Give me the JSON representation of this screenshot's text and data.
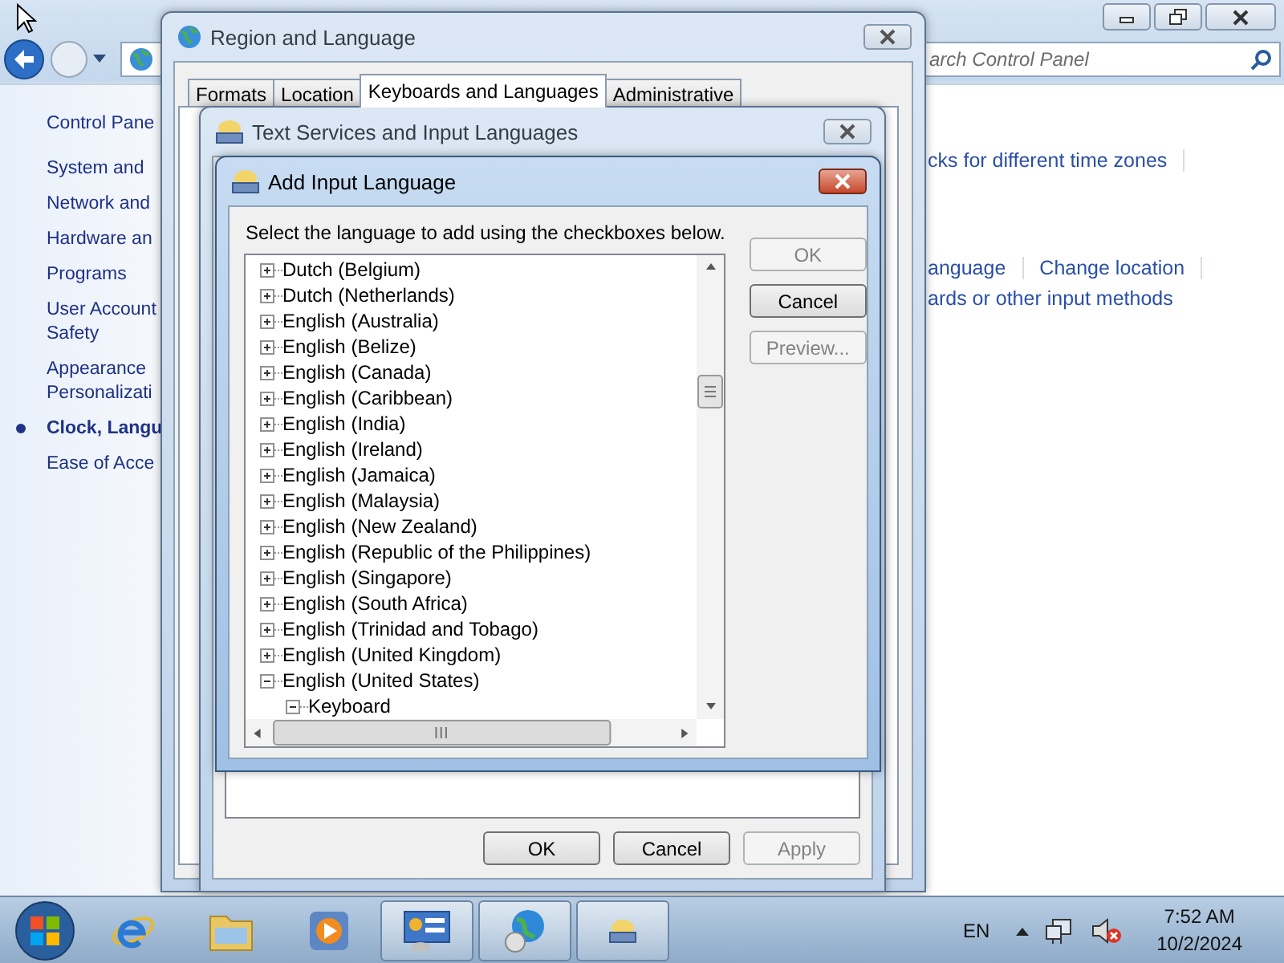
{
  "control_panel": {
    "search": {
      "placeholder": "arch Control Panel"
    },
    "sidebar": {
      "home": "Control Pane",
      "items": [
        {
          "lines": [
            "System and"
          ],
          "selected": false
        },
        {
          "lines": [
            "Network and"
          ],
          "selected": false
        },
        {
          "lines": [
            "Hardware an"
          ],
          "selected": false
        },
        {
          "lines": [
            "Programs"
          ],
          "selected": false
        },
        {
          "lines": [
            "User Account",
            "Safety"
          ],
          "selected": false
        },
        {
          "lines": [
            "Appearance",
            "Personalizati"
          ],
          "selected": false
        },
        {
          "lines": [
            "Clock, Langu"
          ],
          "selected": true
        },
        {
          "lines": [
            "Ease of Acce"
          ],
          "selected": false
        }
      ]
    },
    "link_groups": [
      {
        "rows": [
          {
            "links": [
              "cks for different time zones"
            ],
            "divided": true
          }
        ]
      },
      {
        "rows": [
          {
            "links": [
              "anguage",
              "Change location"
            ],
            "divided": true
          },
          {
            "links": [
              "ards or other input methods"
            ],
            "divided": false
          }
        ]
      }
    ]
  },
  "region_dialog": {
    "title": "Region and Language",
    "tabs": [
      {
        "label": "Formats",
        "selected": false
      },
      {
        "label": "Location",
        "selected": false
      },
      {
        "label": "Keyboards and Languages",
        "selected": true
      },
      {
        "label": "Administrative",
        "selected": false
      }
    ]
  },
  "text_services_dialog": {
    "title": "Text Services and Input Languages",
    "buttons": [
      {
        "label": "OK",
        "disabled": false
      },
      {
        "label": "Cancel",
        "disabled": false
      },
      {
        "label": "Apply",
        "disabled": true
      }
    ]
  },
  "add_input_dialog": {
    "title": "Add Input Language",
    "instruction": "Select the language to add using the checkboxes below.",
    "tree": [
      {
        "label": "Dutch (Belgium)",
        "expanded": false
      },
      {
        "label": "Dutch (Netherlands)",
        "expanded": false
      },
      {
        "label": "English (Australia)",
        "expanded": false
      },
      {
        "label": "English (Belize)",
        "expanded": false
      },
      {
        "label": "English (Canada)",
        "expanded": false
      },
      {
        "label": "English (Caribbean)",
        "expanded": false
      },
      {
        "label": "English (India)",
        "expanded": false
      },
      {
        "label": "English (Ireland)",
        "expanded": false
      },
      {
        "label": "English (Jamaica)",
        "expanded": false
      },
      {
        "label": "English (Malaysia)",
        "expanded": false
      },
      {
        "label": "English (New Zealand)",
        "expanded": false
      },
      {
        "label": "English (Republic of the Philippines)",
        "expanded": false
      },
      {
        "label": "English (Singapore)",
        "expanded": false
      },
      {
        "label": "English (South Africa)",
        "expanded": false
      },
      {
        "label": "English (Trinidad and Tobago)",
        "expanded": false
      },
      {
        "label": "English (United Kingdom)",
        "expanded": false
      },
      {
        "label": "English (United States)",
        "expanded": true,
        "children": [
          {
            "label": "Keyboard",
            "expanded": true
          }
        ]
      }
    ],
    "buttons": [
      {
        "label": "OK",
        "disabled": true
      },
      {
        "label": "Cancel",
        "disabled": false
      },
      {
        "label": "Preview...",
        "disabled": true
      }
    ]
  },
  "taskbar": {
    "apps": [
      {
        "kind": "browser",
        "running": false
      },
      {
        "kind": "folder",
        "running": false
      },
      {
        "kind": "media",
        "running": false
      },
      {
        "kind": "control-panel",
        "running": true
      },
      {
        "kind": "globe",
        "running": true
      },
      {
        "kind": "keyboard",
        "running": true
      }
    ],
    "input_language": "EN",
    "time": "7:52 AM",
    "date": "10/2/2024"
  }
}
